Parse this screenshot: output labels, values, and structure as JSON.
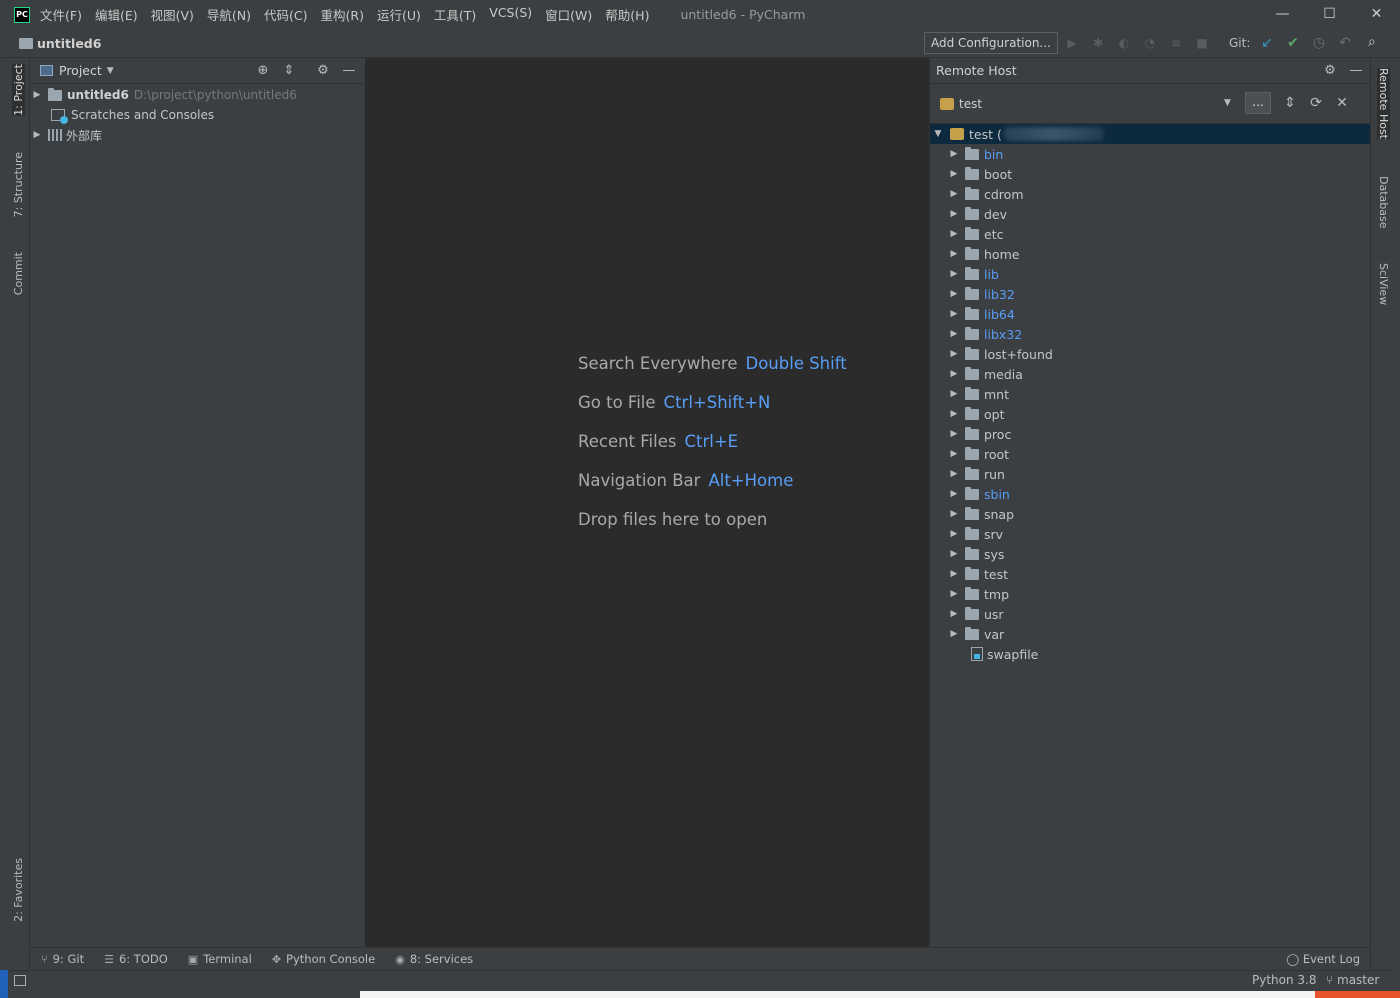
{
  "window": {
    "title": "untitled6 - PyCharm",
    "menu": [
      "文件(F)",
      "编辑(E)",
      "视图(V)",
      "导航(N)",
      "代码(C)",
      "重构(R)",
      "运行(U)",
      "工具(T)",
      "VCS(S)",
      "窗口(W)",
      "帮助(H)"
    ],
    "controls": {
      "minimize": "—",
      "maximize": "☐",
      "close": "✕"
    },
    "logo": "PC"
  },
  "navbar": {
    "project": "untitled6",
    "run_config": "Add Configuration...",
    "git_label": "Git:"
  },
  "left_tabs": {
    "project": "1: Project",
    "structure": "7: Structure",
    "commit": "Commit",
    "favorites": "2: Favorites"
  },
  "project_panel": {
    "title": "Project",
    "tree": [
      {
        "label": "untitled6",
        "path": "D:\\project\\python\\untitled6"
      },
      {
        "label": "Scratches and Consoles"
      },
      {
        "label": "外部库"
      }
    ]
  },
  "editor": {
    "hints": [
      {
        "text": "Search Everywhere",
        "key": "Double Shift"
      },
      {
        "text": "Go to File",
        "key": "Ctrl+Shift+N"
      },
      {
        "text": "Recent Files",
        "key": "Ctrl+E"
      },
      {
        "text": "Navigation Bar",
        "key": "Alt+Home"
      },
      {
        "text": "Drop files here to open",
        "key": ""
      }
    ]
  },
  "remote_host": {
    "title": "Remote Host",
    "server": "test",
    "more_label": "...",
    "root_label": "test (",
    "folders": [
      {
        "name": "bin",
        "link": true
      },
      {
        "name": "boot",
        "link": false
      },
      {
        "name": "cdrom",
        "link": false
      },
      {
        "name": "dev",
        "link": false
      },
      {
        "name": "etc",
        "link": false
      },
      {
        "name": "home",
        "link": false
      },
      {
        "name": "lib",
        "link": true
      },
      {
        "name": "lib32",
        "link": true
      },
      {
        "name": "lib64",
        "link": true
      },
      {
        "name": "libx32",
        "link": true
      },
      {
        "name": "lost+found",
        "link": false
      },
      {
        "name": "media",
        "link": false
      },
      {
        "name": "mnt",
        "link": false
      },
      {
        "name": "opt",
        "link": false
      },
      {
        "name": "proc",
        "link": false
      },
      {
        "name": "root",
        "link": false
      },
      {
        "name": "run",
        "link": false
      },
      {
        "name": "sbin",
        "link": true
      },
      {
        "name": "snap",
        "link": false
      },
      {
        "name": "srv",
        "link": false
      },
      {
        "name": "sys",
        "link": false
      },
      {
        "name": "test",
        "link": false
      },
      {
        "name": "tmp",
        "link": false
      },
      {
        "name": "usr",
        "link": false
      },
      {
        "name": "var",
        "link": false
      }
    ],
    "file": "swapfile"
  },
  "right_tabs": {
    "remote_host": "Remote Host",
    "database": "Database",
    "sciview": "SciView"
  },
  "bottom_tools": [
    {
      "icon": "git-icon",
      "label": "9: Git"
    },
    {
      "icon": "todo-icon",
      "label": "6: TODO"
    },
    {
      "icon": "terminal-icon",
      "label": "Terminal"
    },
    {
      "icon": "python-icon",
      "label": "Python Console"
    },
    {
      "icon": "services-icon",
      "label": "8: Services"
    }
  ],
  "event_log": "Event Log",
  "statusbar": {
    "interpreter": "Python 3.8",
    "branch": "master"
  },
  "colors": {
    "accent_link": "#589df6",
    "editor_bg": "#2b2b2b",
    "panel_bg": "#3c3f41",
    "selection_bg": "#0d293e"
  }
}
